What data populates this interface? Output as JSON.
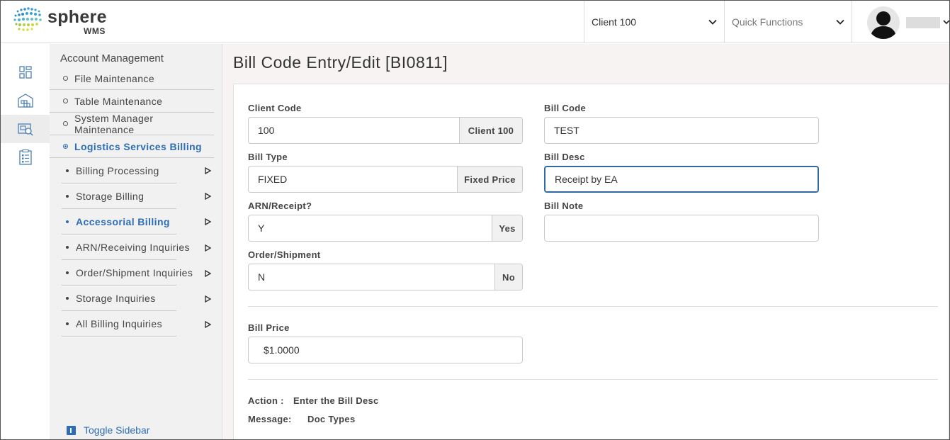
{
  "header": {
    "logo_text": "sphere",
    "logo_sub": "WMS",
    "client_select": "Client 100",
    "quick_functions_placeholder": "Quick Functions"
  },
  "rail": {
    "icons": [
      "dashboard-icon",
      "warehouse-icon",
      "billing-icon",
      "checklist-icon"
    ]
  },
  "sidebar": {
    "title": "Account Management",
    "items": [
      {
        "label": "File Maintenance"
      },
      {
        "label": "Table Maintenance"
      },
      {
        "label": "System Manager Maintenance"
      },
      {
        "label": "Logistics Services Billing",
        "active": true
      }
    ],
    "subitems": [
      {
        "label": "Billing Processing"
      },
      {
        "label": "Storage Billing"
      },
      {
        "label": "Accessorial Billing",
        "active": true
      },
      {
        "label": "ARN/Receiving Inquiries"
      },
      {
        "label": "Order/Shipment Inquiries"
      },
      {
        "label": "Storage Inquiries"
      },
      {
        "label": "All Billing Inquiries"
      }
    ],
    "toggle_label": "Toggle Sidebar"
  },
  "main": {
    "title": "Bill Code Entry/Edit [BI0811]",
    "fields": {
      "client_code": {
        "label": "Client Code",
        "value": "100",
        "addon": "Client 100"
      },
      "bill_code": {
        "label": "Bill Code",
        "value": "TEST"
      },
      "bill_type": {
        "label": "Bill Type",
        "value": "FIXED",
        "addon": "Fixed Price"
      },
      "bill_desc": {
        "label": "Bill Desc",
        "value": "Receipt by EA"
      },
      "arn_receipt": {
        "label": "ARN/Receipt?",
        "value": "Y",
        "addon": "Yes"
      },
      "bill_note": {
        "label": "Bill Note",
        "value": ""
      },
      "order_shipment": {
        "label": "Order/Shipment",
        "value": "N",
        "addon": "No"
      },
      "bill_price": {
        "label": "Bill Price",
        "value": "$1.0000"
      }
    },
    "action_label": "Action :",
    "action_value": "Enter the Bill Desc",
    "message_label": "Message:",
    "message_value": "Doc Types"
  },
  "colors": {
    "accent": "#2e6db4",
    "focus_border": "#2f6aa6",
    "sidebar_bg": "#f1f1f1",
    "main_bg": "#f7f3f3"
  }
}
